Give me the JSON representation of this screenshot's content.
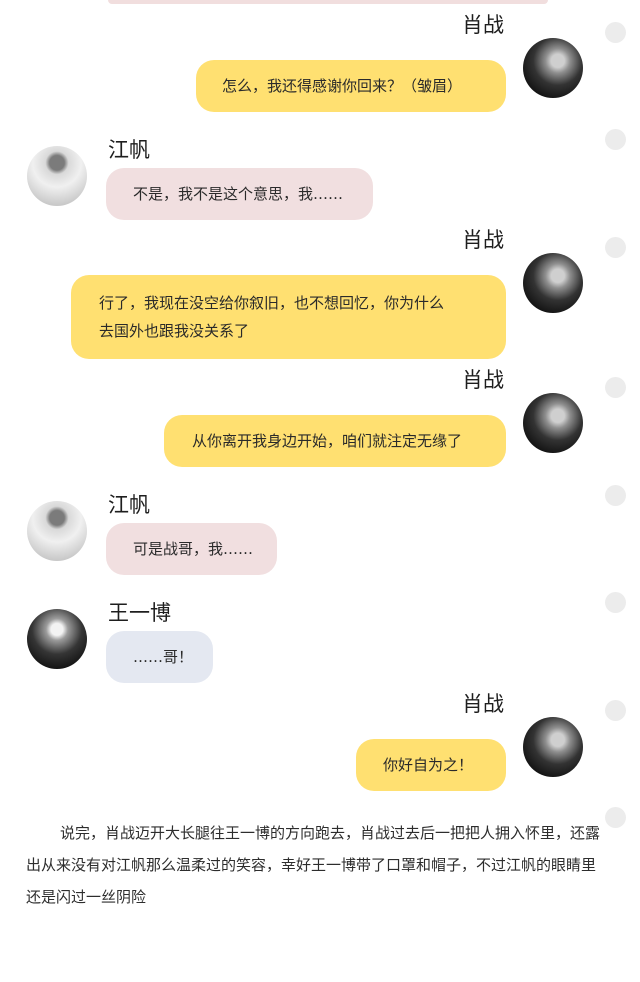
{
  "messages": [
    {
      "speaker": "肖战",
      "side": "right",
      "avatar_icon": "xiao-zhan-avatar-icon",
      "text": "怎么，我还得感谢你回来？（皱眉）"
    },
    {
      "speaker": "江帆",
      "side": "left",
      "avatar_icon": "jiang-fan-avatar-icon",
      "text": "不是，我不是这个意思，我……"
    },
    {
      "speaker": "肖战",
      "side": "right",
      "avatar_icon": "xiao-zhan-avatar-icon",
      "text": "行了，我现在没空给你叙旧，也不想回忆，你为什么\n去国外也跟我没关系了"
    },
    {
      "speaker": "肖战",
      "side": "right",
      "avatar_icon": "xiao-zhan-avatar-icon",
      "text": "从你离开我身边开始，咱们就注定无缘了"
    },
    {
      "speaker": "江帆",
      "side": "left",
      "avatar_icon": "jiang-fan-avatar-icon",
      "text": "可是战哥，我……"
    },
    {
      "speaker": "王一博",
      "side": "left",
      "avatar_icon": "wang-yibo-avatar-icon",
      "text": "……哥！"
    },
    {
      "speaker": "肖战",
      "side": "right",
      "avatar_icon": "xiao-zhan-avatar-icon",
      "text": "你好自为之！"
    }
  ],
  "narration": "说完，肖战迈开大长腿往王一博的方向跑去，肖战过去后一把把人拥入怀里，还露出从来没有对江帆那么温柔过的笑容，幸好王一博带了口罩和帽子，不过江帆的眼睛里还是闪过一丝阴险",
  "colors": {
    "right_bubble": "#ffe071",
    "left_bubble_jiangfan": "#f1dfe0",
    "left_bubble_wangyibo": "#e4e8f1"
  }
}
